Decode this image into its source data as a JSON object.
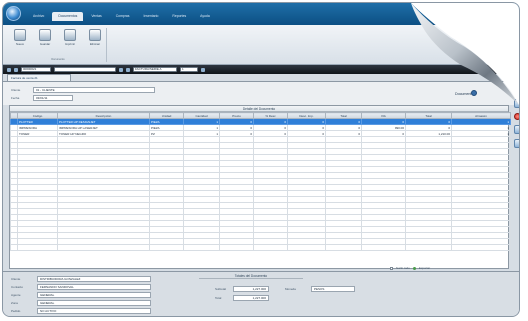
{
  "ribbon": {
    "tabs": [
      {
        "label": "Archivo"
      },
      {
        "label": "Documentos"
      },
      {
        "label": "Ventas"
      },
      {
        "label": "Compras"
      },
      {
        "label": "Inventario"
      },
      {
        "label": "Reportes"
      },
      {
        "label": "Ayuda"
      }
    ],
    "buttons": [
      {
        "label": "Nuevo"
      },
      {
        "label": "Guardar"
      },
      {
        "label": "Imprimir"
      },
      {
        "label": "Eliminar"
      }
    ],
    "group_label": "Documento"
  },
  "navbar": {
    "doc_number": "00000021",
    "series": "FACTURA/SERIE A",
    "page": "1"
  },
  "doc_tab": {
    "label": "Factura de venta 21"
  },
  "header": {
    "fields": [
      {
        "label": "Cliente",
        "value": "01 - CLIENTE"
      },
      {
        "label": "Fecha",
        "value": "03/01/11"
      }
    ],
    "status_label": "Documento"
  },
  "grid": {
    "caption": "Detalle del Documento",
    "columns": [
      "",
      "Código",
      "Descripción",
      "Unidad",
      "Cantidad",
      "Precio",
      "% Desc",
      "Desc. Imp.",
      "Total",
      "IVA",
      "Total",
      "Almacén"
    ],
    "rows": [
      {
        "cells": [
          "",
          "PLOTTER",
          "PLOTTER HP DESIGNJET",
          "PIEZA",
          "1",
          "0",
          "0",
          "0",
          "0",
          "0",
          "0",
          "1"
        ],
        "selected": true
      },
      {
        "cells": [
          "",
          "IMPRESORA",
          "IMPRESORA HP LASERJET",
          "PIEZA",
          "1",
          "0",
          "0",
          "0",
          "0",
          "990.00",
          "0",
          "1"
        ],
        "selected": false
      },
      {
        "cells": [
          "",
          "TONER",
          "TONER HP NEGRO",
          "PZ",
          "1",
          "0",
          "0",
          "0",
          "0",
          "0",
          "1,210.00",
          "1"
        ],
        "selected": false
      }
    ],
    "footer": {
      "opt1": "Surtir todo",
      "opt2": "Exportar"
    }
  },
  "bottom": {
    "fields": [
      {
        "label": "Cliente",
        "value": "DISTRIBUIDORA GONZALEZ"
      },
      {
        "label": "Contacto",
        "value": "FERNANDO SANDOVAL"
      },
      {
        "label": "Agente",
        "value": "GENERAL"
      },
      {
        "label": "Zona",
        "value": "GENERAL"
      },
      {
        "label": "Pedido",
        "value": "NO ACTIVO"
      }
    ],
    "totals_title": "Totales del Documento",
    "subtotal_label": "Subtotal",
    "subtotal_value": "1,227.000",
    "total_label": "Total",
    "total_value": "1,227.000",
    "currency_label": "Moneda",
    "currency_value": "PESOS"
  },
  "colors": {
    "selection": "#2f7fd8",
    "title": "#0c4f83",
    "navbar": "#0f141a"
  }
}
